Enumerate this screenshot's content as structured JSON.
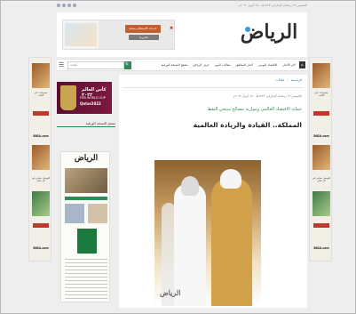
{
  "top_strip": {
    "date_text": "الخميس ٢٦ رمضان الإماراتي ١٤٤٣هـ - ٢٨ أبريل ٢٠٢٢م",
    "social_icons": [
      "facebook-icon",
      "twitter-icon",
      "instagram-icon",
      "youtube-icon"
    ]
  },
  "header": {
    "logo_text": "الرياض",
    "ad": {
      "close_symbol": "✖",
      "badge_text": "خدمات الاستعلام بمنصة البركة",
      "badge_sub": "إلكترونياً"
    }
  },
  "nav": {
    "search_placeholder": "البحث",
    "search_button": "🔍",
    "menu_icon": "☰",
    "home_icon": "⌂",
    "items": [
      "آخر الأخبار",
      "الاقتصاد اليومي",
      "أخبار المناطق",
      "مقالات اليوم",
      "حرف الرياض",
      "تصفح النسخة الورقية"
    ]
  },
  "sidebar": {
    "wc_ad": {
      "title": "كأس العالم ٢٠٢٢",
      "subtitle": "FIFA WORLD CUP",
      "subtitle2": "Qatar2022"
    },
    "archive_title": "تصفح النسخة الورقية",
    "newspaper_mast": "الرياض"
  },
  "article": {
    "breadcrumb": [
      "الرئيسية",
      "مقالات"
    ],
    "meta": "الخميس ٢٦ رمضان الإماراتي ١٤٤٣هـ - ٢٨ أبريل ٢٠٢٢م",
    "subhead": "حماية الاقتصاد العالمي وموازنة مصالح منتجي النفط",
    "headline": "المملكة.. القيادة والريادة العالمية",
    "photo_watermark": "الرياض"
  },
  "side_ads": {
    "brand": "BIGA.com",
    "line1": "خصومات على الكتب",
    "line2": "التوصيل مجاني في كل مكان"
  }
}
